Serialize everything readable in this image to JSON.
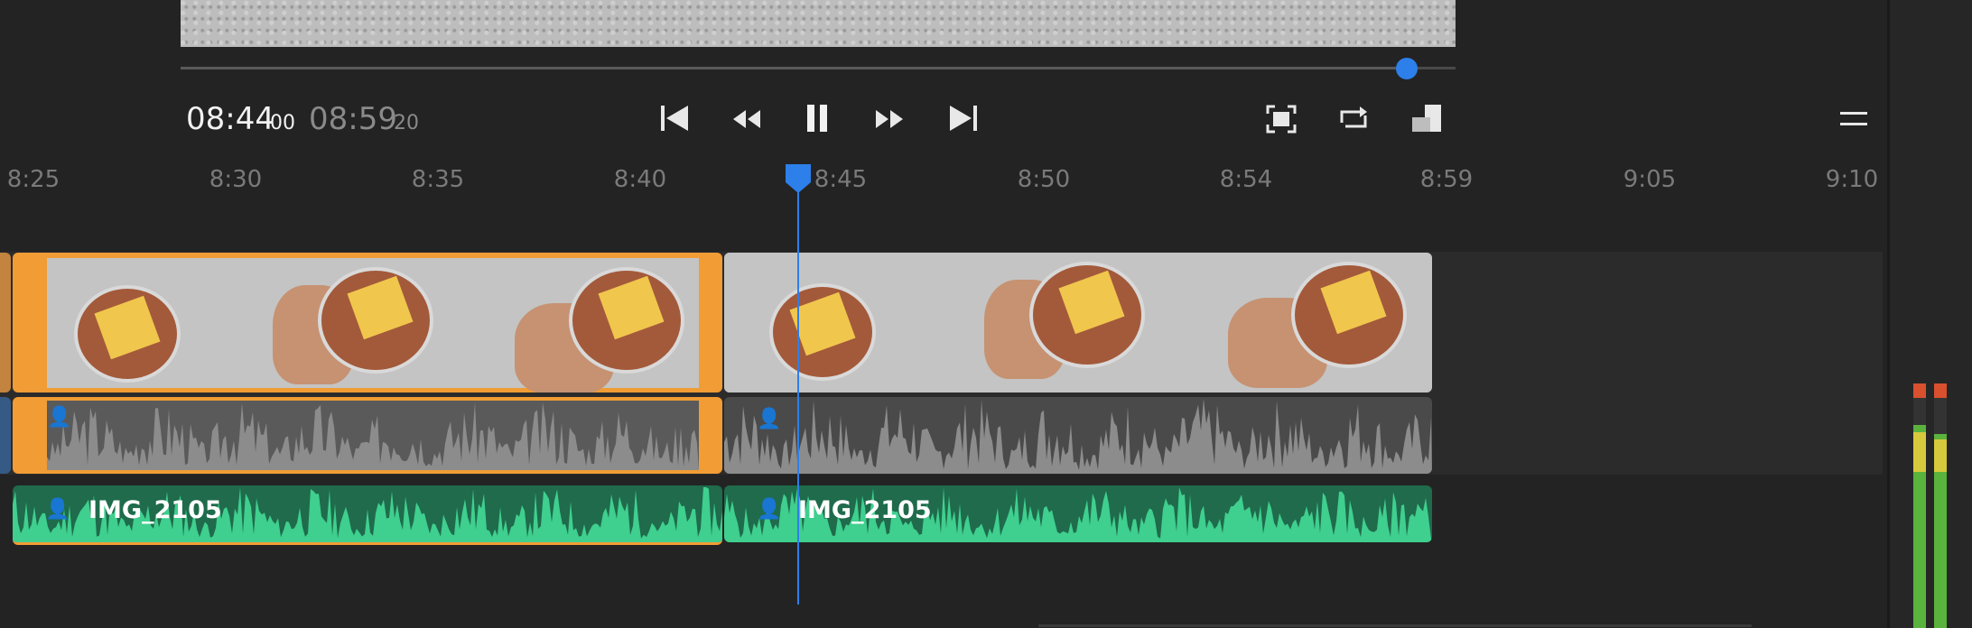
{
  "timecode": {
    "current": "08:44",
    "current_frames": "00",
    "total": "08:59",
    "total_frames": "20"
  },
  "controls": {
    "skip_back": "skip-to-start-icon",
    "rewind": "rewind-icon",
    "pause": "pause-icon",
    "forward": "fast-forward-icon",
    "skip_end": "skip-to-end-icon",
    "fullscreen": "fullscreen-icon",
    "loop": "loop-icon",
    "display": "display-size-icon",
    "menu": "menu-icon"
  },
  "scrubber": {
    "progress_fraction": 0.962
  },
  "ruler": {
    "ticks": [
      "8:25",
      "8:30",
      "8:35",
      "8:40",
      "8:45",
      "8:50",
      "8:54",
      "8:59",
      "9:05",
      "9:10"
    ]
  },
  "clips": {
    "audio_a_label": "IMG_2105",
    "audio_b_label": "IMG_2105"
  },
  "colors": {
    "accent": "#2d7fea",
    "selected": "#f19c35",
    "music": "#1f6b4c",
    "music_wave": "#3fcf8e"
  }
}
